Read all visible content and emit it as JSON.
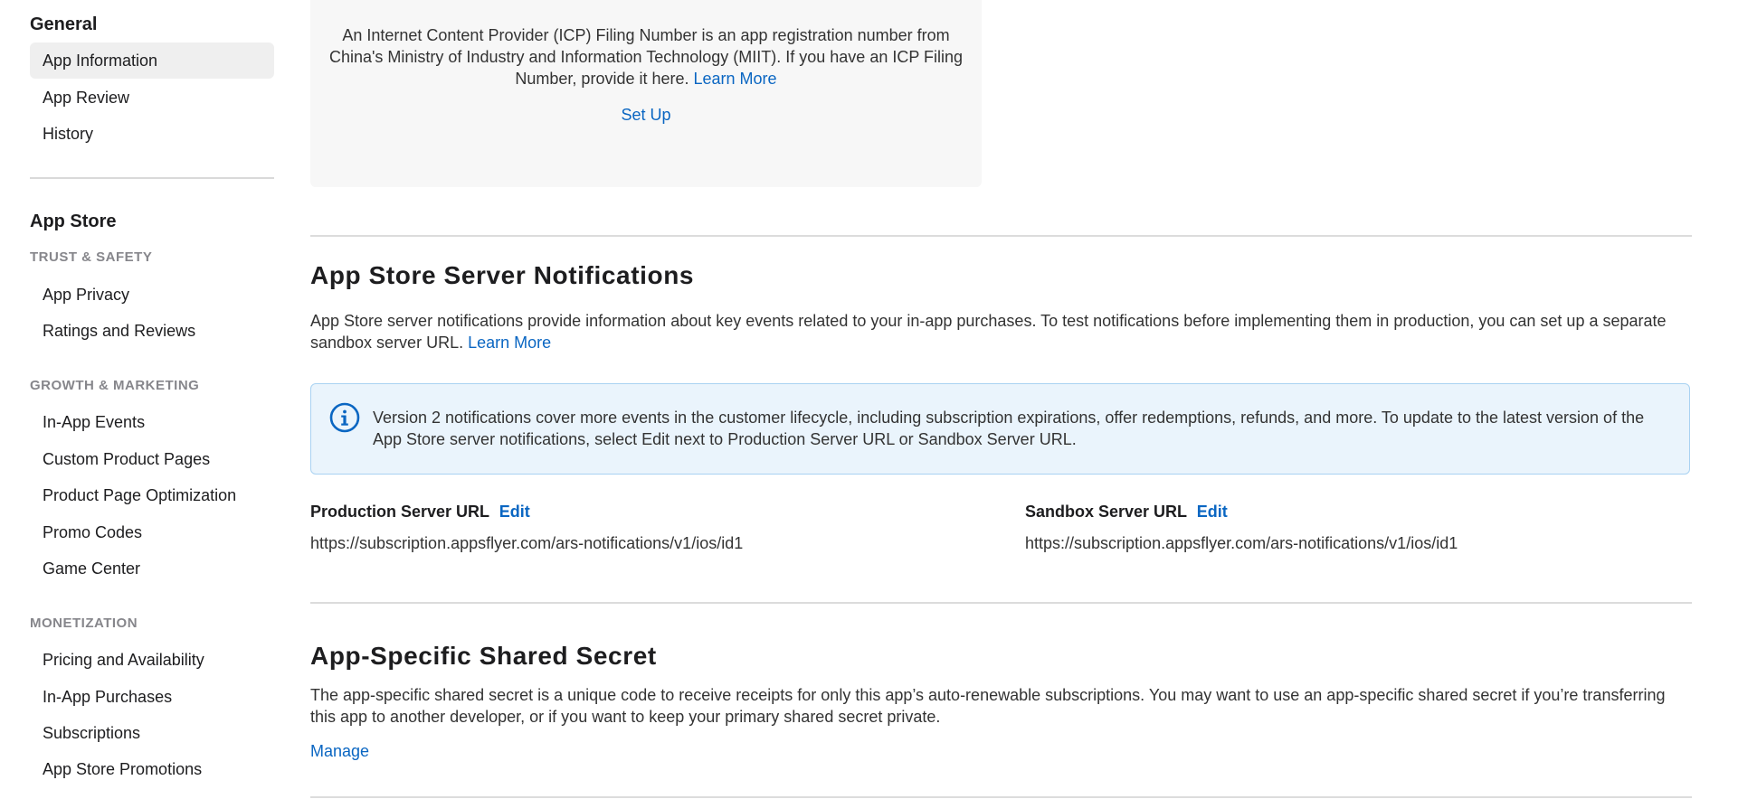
{
  "sidebar": {
    "general": {
      "title": "General",
      "items": [
        {
          "label": "App Information",
          "active": true
        },
        {
          "label": "App Review"
        },
        {
          "label": "History"
        }
      ]
    },
    "app_store": {
      "title": "App Store",
      "sections": [
        {
          "label": "TRUST & SAFETY",
          "items": [
            "App Privacy",
            "Ratings and Reviews"
          ]
        },
        {
          "label": "GROWTH & MARKETING",
          "items": [
            "In-App Events",
            "Custom Product Pages",
            "Product Page Optimization",
            "Promo Codes",
            "Game Center"
          ]
        },
        {
          "label": "MONETIZATION",
          "items": [
            "Pricing and Availability",
            "In-App Purchases",
            "Subscriptions",
            "App Store Promotions"
          ]
        }
      ]
    }
  },
  "icp": {
    "text": "An Internet Content Provider (ICP) Filing Number is an app registration number from China's Ministry of Industry and Information Technology (MIIT). If you have an ICP Filing Number, provide it here.",
    "learn_more": "Learn More",
    "setup": "Set Up"
  },
  "notifications": {
    "title": "App Store Server Notifications",
    "description": "App Store server notifications provide information about key events related to your in-app purchases. To test notifications before implementing them in production, you can set up a separate sandbox server URL.",
    "learn_more": "Learn More",
    "info_icon": "info-circle-icon",
    "info_text": "Version 2 notifications cover more events in the customer lifecycle, including subscription expirations, offer redemptions, refunds, and more. To update to the latest version of the App Store server notifications, select Edit next to Production Server URL or Sandbox Server URL.",
    "production": {
      "label": "Production Server URL",
      "edit": "Edit",
      "url": "https://subscription.appsflyer.com/ars-notifications/v1/ios/id1"
    },
    "sandbox": {
      "label": "Sandbox Server URL",
      "edit": "Edit",
      "url": "https://subscription.appsflyer.com/ars-notifications/v1/ios/id1"
    }
  },
  "shared_secret": {
    "title": "App-Specific Shared Secret",
    "description": "The app-specific shared secret is a unique code to receive receipts for only this app’s auto-renewable subscriptions. You may want to use an app-specific shared secret if you’re transferring this app to another developer, or if you want to keep your primary shared secret private.",
    "manage": "Manage"
  },
  "colors": {
    "link": "#0a66c2",
    "active_item_bg": "#efefef",
    "info_bg": "#eaf4fc",
    "info_border": "#a9d2f2",
    "icp_bg": "#f7f7f7"
  }
}
